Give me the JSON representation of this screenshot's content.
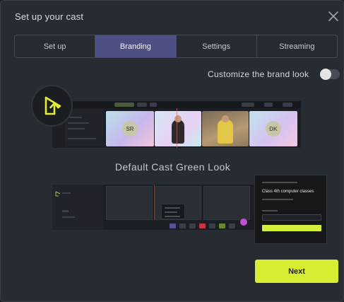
{
  "dialog": {
    "title": "Set up your cast"
  },
  "tabs": [
    {
      "label": "Set up",
      "active": false
    },
    {
      "label": "Branding",
      "active": true
    },
    {
      "label": "Settings",
      "active": false
    },
    {
      "label": "Streaming",
      "active": false
    }
  ],
  "branding": {
    "customize_label": "Customize the brand look",
    "customize_enabled": false
  },
  "preview_top": {
    "tiles": [
      {
        "initials": "SR"
      },
      {
        "initials": ""
      },
      {
        "initials": ""
      },
      {
        "initials": "DK"
      }
    ]
  },
  "preset": {
    "label": "Default Cast Green Look"
  },
  "preview_popup": {
    "title": "Class 4th computer classes"
  },
  "footer": {
    "next_label": "Next"
  },
  "colors": {
    "accent": "#d7ed31",
    "active_tab": "#4e4f82",
    "background": "#272c33"
  },
  "icons": {
    "close": "close-icon",
    "logo": "cast-logo-icon"
  }
}
